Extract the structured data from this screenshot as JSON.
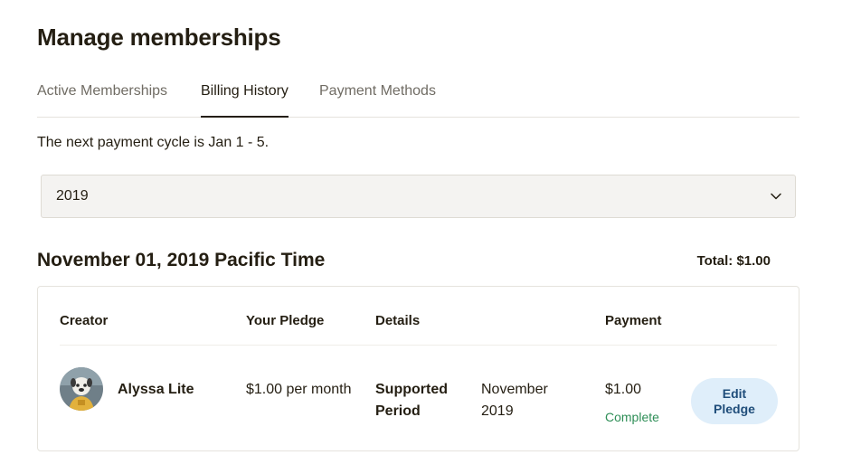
{
  "page": {
    "title": "Manage memberships"
  },
  "tabs": [
    {
      "label": "Active Memberships",
      "active": false
    },
    {
      "label": "Billing History",
      "active": true
    },
    {
      "label": "Payment Methods",
      "active": false
    }
  ],
  "billing": {
    "cycle_note": "The next payment cycle is Jan 1 - 5.",
    "year_select": {
      "value": "2019",
      "icon": "chevron-down-icon"
    },
    "date_heading": "November 01, 2019 Pacific Time",
    "total": "Total: $1.00"
  },
  "table": {
    "headers": {
      "creator": "Creator",
      "pledge": "Your Pledge",
      "details": "Details",
      "payment": "Payment"
    },
    "rows": [
      {
        "creator_name": "Alyssa Lite",
        "pledge": "$1.00 per month",
        "detail_label": "Supported Period",
        "detail_value": "November 2019",
        "payment_amount": "$1.00",
        "payment_status": "Complete",
        "action_label": "Edit Pledge"
      }
    ]
  },
  "colors": {
    "text": "#241e12",
    "muted": "#706c64",
    "status_complete": "#2e8e57",
    "button_bg": "#dfeefa",
    "button_text": "#1f4d7a"
  }
}
